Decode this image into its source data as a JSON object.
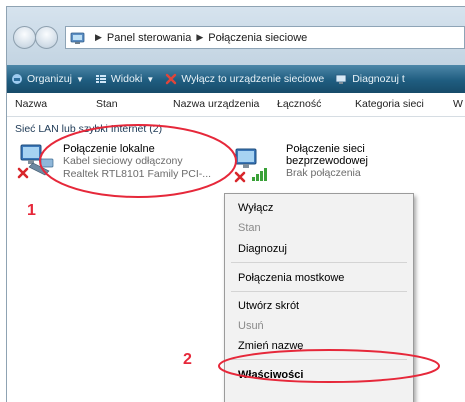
{
  "address": {
    "crumbs": [
      "Panel sterowania",
      "Połączenia sieciowe"
    ]
  },
  "toolbar": {
    "items": [
      {
        "label": "Organizuj",
        "icon": "organize-icon",
        "caret": true
      },
      {
        "label": "Widoki",
        "icon": "views-icon",
        "caret": true
      },
      {
        "label": "Wyłącz to urządzenie sieciowe",
        "icon": "disable-icon",
        "caret": false
      },
      {
        "label": "Diagnozuj t",
        "icon": "diagnose-icon",
        "caret": false
      }
    ]
  },
  "columns": [
    "Nazwa",
    "Stan",
    "Nazwa urządzenia",
    "Łączność",
    "Kategoria sieci",
    "W"
  ],
  "group_title": "Sieć LAN lub szybki Internet (2)",
  "connections": [
    {
      "name": "Połączenie lokalne",
      "status": "Kabel sieciowy odłączony",
      "device": "Realtek RTL8101 Family PCI-..."
    },
    {
      "name_line1": "Połączenie sieci",
      "name_line2": "bezprzewodowej",
      "status": "Brak połączenia"
    }
  ],
  "context_menu": {
    "items": [
      {
        "label": "Wyłącz",
        "enabled": true
      },
      {
        "label": "Stan",
        "enabled": false
      },
      {
        "label": "Diagnozuj",
        "enabled": true
      },
      {
        "label": "Połączenia mostkowe",
        "enabled": true
      },
      {
        "label": "Utwórz skrót",
        "enabled": true
      },
      {
        "label": "Usuń",
        "enabled": false
      },
      {
        "label": "Zmień nazwę",
        "enabled": true
      },
      {
        "label": "Właściwości",
        "enabled": true,
        "bold": true
      }
    ]
  },
  "annotations": {
    "mark1": "1",
    "mark2": "2",
    "color": "#e6283a"
  }
}
